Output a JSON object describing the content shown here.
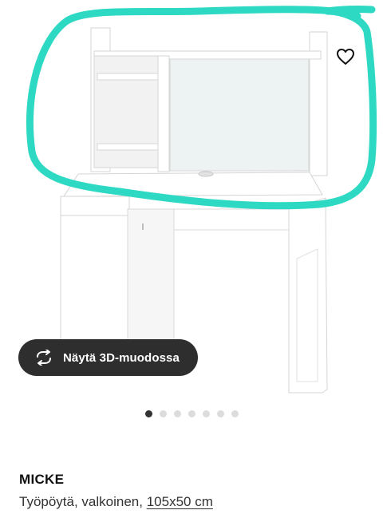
{
  "gallery": {
    "favorite_icon": "heart-outline-icon",
    "view_3d": {
      "label": "Näytä 3D-muodossa",
      "icon": "rotate-arrows-icon"
    },
    "pagination": {
      "total": 7,
      "active_index": 0
    },
    "annotation_color": "#2ed9c3"
  },
  "product": {
    "name": "MICKE",
    "description_prefix": "Työpöytä, valkoinen,",
    "size_link": "105x50 cm"
  }
}
